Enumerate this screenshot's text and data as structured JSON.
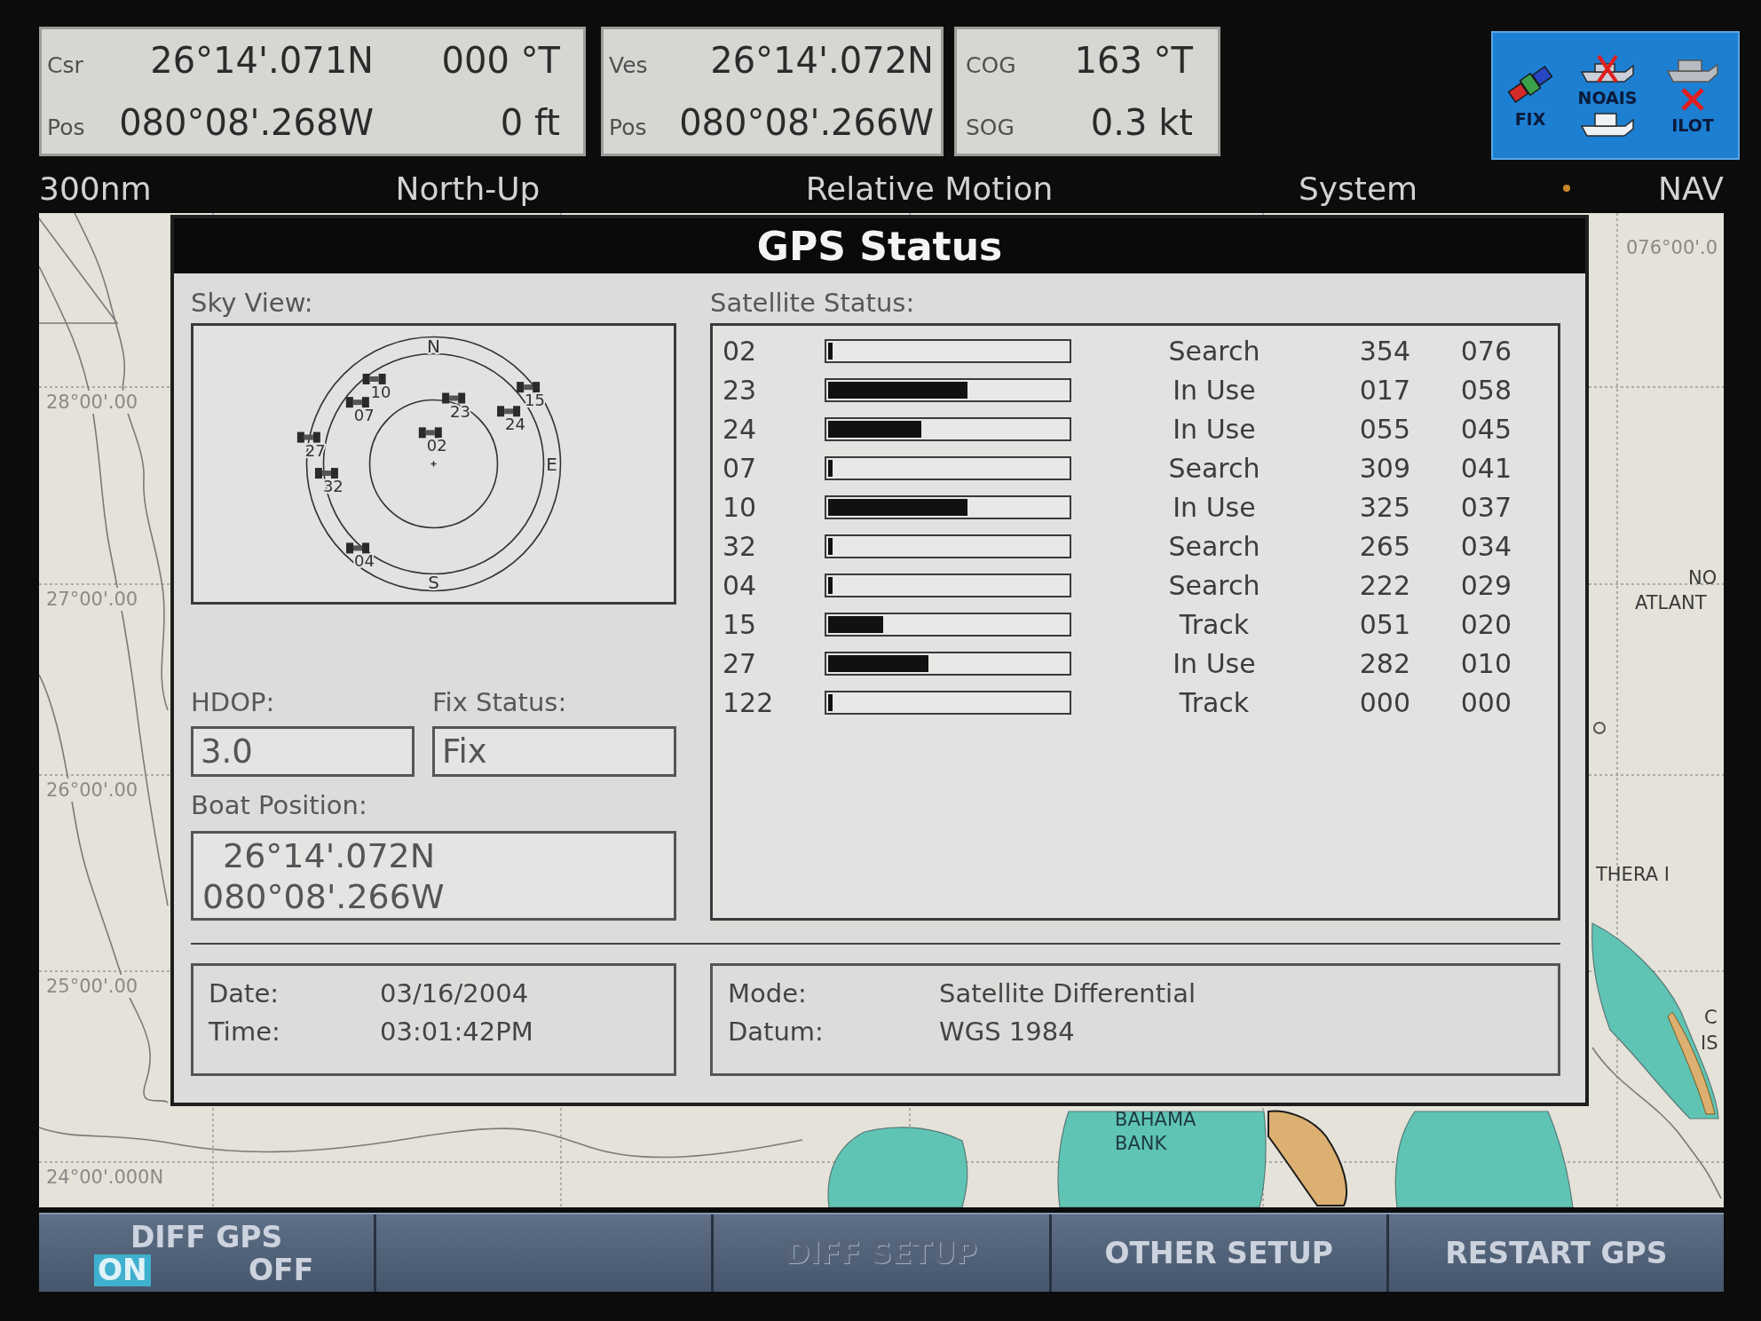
{
  "readouts": [
    {
      "rows": [
        {
          "label": "Csr",
          "value": "26°14'.071N",
          "reading": "000 °T"
        },
        {
          "label": "Pos",
          "value": "080°08'.268W",
          "reading": "0 ft"
        }
      ]
    },
    {
      "rows": [
        {
          "label": "Ves",
          "value": "26°14'.072N"
        },
        {
          "label": "Pos",
          "value": "080°08'.266W"
        }
      ]
    },
    {
      "rows": [
        {
          "label": "COG",
          "value": "163 °T"
        },
        {
          "label": "SOG",
          "value": "0.3 kt"
        }
      ]
    }
  ],
  "status_icons": [
    {
      "kind": "fix",
      "label": "FIX"
    },
    {
      "kind": "ais",
      "label": "NOAIS"
    },
    {
      "kind": "pilot",
      "label": "ILOT"
    }
  ],
  "chart_header": {
    "scale": "300nm",
    "items": [
      "North-Up",
      "Relative Motion",
      "System"
    ],
    "mode": "NAV"
  },
  "map": {
    "labels": [
      {
        "kind": "grid",
        "text": "28°00'.00"
      },
      {
        "kind": "grid",
        "text": "27°00'.00"
      },
      {
        "kind": "grid",
        "text": "26°00'.00"
      },
      {
        "kind": "grid",
        "text": "25°00'.00"
      },
      {
        "kind": "grid",
        "text": "24°00'.000N"
      },
      {
        "kind": "grid",
        "text": "076°00'.0"
      },
      {
        "kind": "place",
        "text": "NO"
      },
      {
        "kind": "place",
        "text": "ATLANT"
      },
      {
        "kind": "place",
        "text": "THERA I"
      },
      {
        "kind": "place",
        "text": "C"
      },
      {
        "kind": "place",
        "text": "IS"
      },
      {
        "kind": "area",
        "text": "BAHAMA BANK"
      }
    ]
  },
  "dialog": {
    "title": "GPS Status",
    "sky_view": {
      "label": "Sky View:",
      "compass": [
        {
          "kind": "north",
          "label": "N"
        },
        {
          "kind": "east",
          "label": "E"
        },
        {
          "kind": "south",
          "label": "S"
        }
      ],
      "satellites": [
        {
          "label": "02"
        },
        {
          "label": "23"
        },
        {
          "label": "24"
        },
        {
          "label": "07"
        },
        {
          "label": "10"
        },
        {
          "label": "32"
        },
        {
          "label": "04"
        },
        {
          "label": "15"
        },
        {
          "label": "27"
        }
      ]
    },
    "satellite_status": {
      "label": "Satellite Status:",
      "rows": [
        {
          "column_1": "02",
          "level": 0.02,
          "column_3": "Search",
          "column_4": "354",
          "column_5": "076"
        },
        {
          "column_1": "23",
          "level": 0.58,
          "column_3": "In Use",
          "column_4": "017",
          "column_5": "058"
        },
        {
          "column_1": "24",
          "level": 0.39,
          "column_3": "In Use",
          "column_4": "055",
          "column_5": "045"
        },
        {
          "column_1": "07",
          "level": 0.02,
          "column_3": "Search",
          "column_4": "309",
          "column_5": "041"
        },
        {
          "column_1": "10",
          "level": 0.58,
          "column_3": "In Use",
          "column_4": "325",
          "column_5": "037"
        },
        {
          "column_1": "32",
          "level": 0.02,
          "column_3": "Search",
          "column_4": "265",
          "column_5": "034"
        },
        {
          "column_1": "04",
          "level": 0.02,
          "column_3": "Search",
          "column_4": "222",
          "column_5": "029"
        },
        {
          "column_1": "15",
          "level": 0.23,
          "column_3": "Track",
          "column_4": "051",
          "column_5": "020"
        },
        {
          "column_1": "27",
          "level": 0.42,
          "column_3": "In Use",
          "column_4": "282",
          "column_5": "010"
        },
        {
          "column_1": "122",
          "level": 0.02,
          "column_3": "Track",
          "column_4": "000",
          "column_5": "000"
        }
      ]
    },
    "hdop": {
      "label": "HDOP:",
      "value": "3.0"
    },
    "fix_status": {
      "label": "Fix Status:",
      "value": "Fix"
    },
    "boat_position": {
      "label": "Boat Position:",
      "latitude": "26°14'.072N",
      "longitude": "080°08'.266W"
    },
    "date_time": [
      {
        "label": "Date:",
        "value": "03/16/2004"
      },
      {
        "label": "Time:",
        "value": "03:01:42PM"
      }
    ],
    "mode_datum": [
      {
        "label": "Mode:",
        "value": "Satellite Differential"
      },
      {
        "label": "Datum:",
        "value": "WGS 1984"
      }
    ]
  },
  "softkeys": [
    {
      "kind": "toggle",
      "label": "DIFF GPS",
      "options": [
        {
          "label": "ON",
          "selected": true
        },
        {
          "label": "OFF",
          "selected": false
        }
      ]
    },
    {
      "kind": "blank"
    },
    {
      "kind": "button",
      "label": "DIFF SETUP",
      "disabled": true
    },
    {
      "kind": "button",
      "label": "OTHER SETUP",
      "disabled": false
    },
    {
      "kind": "button",
      "label": "RESTART GPS",
      "disabled": false
    }
  ]
}
